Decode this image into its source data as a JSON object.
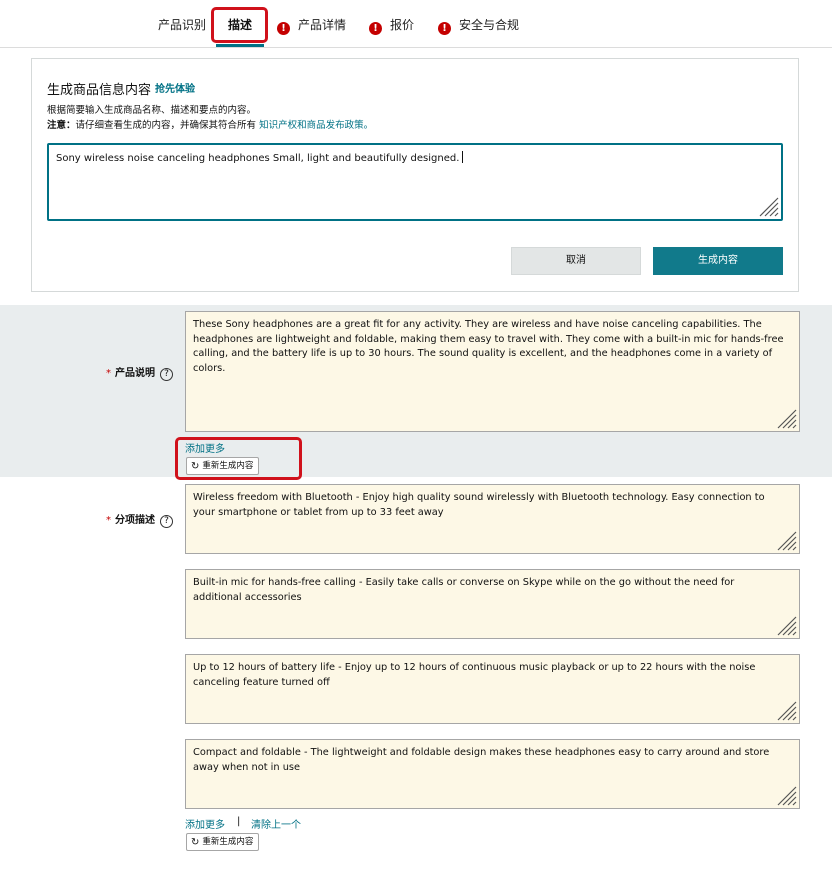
{
  "tabs": [
    {
      "label": "产品识别",
      "warning": false
    },
    {
      "label": "描述",
      "warning": false,
      "active": true
    },
    {
      "label": "产品详情",
      "warning": true
    },
    {
      "label": "报价",
      "warning": true
    },
    {
      "label": "安全与合规",
      "warning": true
    }
  ],
  "generator": {
    "title": "生成商品信息内容",
    "badge": "抢先体验",
    "description": "根据简要输入生成商品名称、描述和要点的内容。",
    "note_label": "注意：",
    "note_text": "请仔细查看生成的内容，并确保其符合所有",
    "note_link": "知识产权和商品发布政策",
    "note_end": "。",
    "prompt_value": "Sony wireless noise canceling headphones Small, light and beautifully designed.",
    "cancel_label": "取消",
    "generate_label": "生成内容"
  },
  "product_description": {
    "label": "产品说明",
    "required_mark": "*",
    "help": "?",
    "value": "These Sony headphones are a great fit for any activity. They are wireless and have noise canceling capabilities. The headphones are lightweight and foldable, making them easy to travel with. They come with a built-in mic for hands-free calling, and the battery life is up to 30 hours. The sound quality is excellent, and the headphones come in a variety of colors.",
    "add_more": "添加更多",
    "regenerate": "重新生成内容"
  },
  "bullet_points": {
    "label": "分项描述",
    "required_mark": "*",
    "help": "?",
    "items": [
      "Wireless freedom with Bluetooth - Enjoy high quality sound wirelessly with Bluetooth technology. Easy connection to your smartphone or tablet from up to 33 feet away",
      "Built-in mic for hands-free calling - Easily take calls or converse on Skype while on the go without the need for additional accessories",
      "Up to 12 hours of battery life - Enjoy up to 12 hours of continuous music playback or up to 22 hours with the noise canceling feature turned off",
      "Compact and foldable - The lightweight and foldable design makes these headphones easy to carry around and store away when not in use"
    ],
    "add_more": "添加更多",
    "separator": "|",
    "clear_last": "清除上一个",
    "regenerate": "重新生成内容"
  },
  "colors": {
    "accent": "#007185",
    "button": "#117a8b",
    "highlight": "#d0111b",
    "textarea_bg": "#fdf8e6",
    "section_bg": "#e9edee"
  }
}
